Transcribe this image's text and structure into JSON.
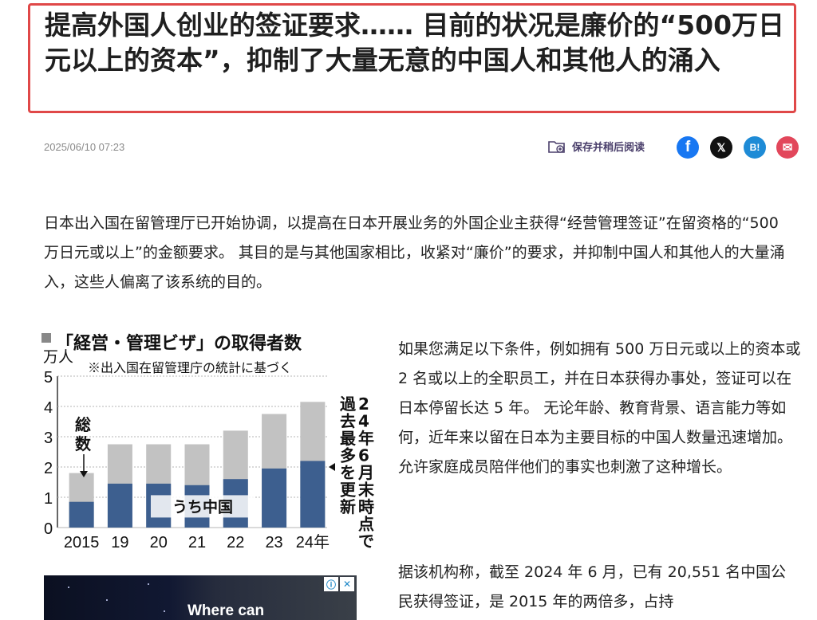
{
  "article": {
    "headline": "提高外国人创业的签证要求…… 目前的状况是廉价的“500万日元以上的资本”，抑制了大量无意的中国人和其他人的涌入",
    "date": "2025/06/10 07:23",
    "save_label": "保存并稍后阅读",
    "intro": "日本出入国在留管理厅已开始协调，以提高在日本开展业务的外国企业主获得“经营管理签证”在留资格的“500 万日元或以上”的金额要求。 其目的是与其他国家相比，收紧对“廉价”的要求，并抑制中国人和其他人的大量涌入，这些人偏离了该系统的目的。",
    "para2": "如果您满足以下条件，例如拥有 500 万日元或以上的资本或 2 名或以上的全职员工，并在日本获得办事处，签证可以在日本停留长达 5 年。 无论年龄、教育背景、语言能力等如何，近年来以留在日本为主要目标的中国人数量迅速增加。 允许家庭成员陪伴他们的事实也刺激了这种增长。",
    "para3": "据该机构称，截至 2024 年 6 月，已有 20,551 名中国公民获得签证，是 2015 年的两倍多，占持"
  },
  "share": {
    "facebook": "f",
    "x": "𝕏",
    "hatena": "B!",
    "mail": "✉"
  },
  "icons": {
    "save": "folder-add-icon",
    "facebook": "facebook-icon",
    "x": "x-icon",
    "hatena": "hatena-icon",
    "mail": "mail-icon"
  },
  "ad": {
    "text": "Where can",
    "info": "ⓘ",
    "close": "✕"
  },
  "chart_data": {
    "type": "bar",
    "title": "「経営・管理ビザ」の取得者数",
    "subtitle": "※出入国在留管理庁の統計に基づく",
    "ylabel": "万人",
    "ylim": [
      0,
      5
    ],
    "yticks": [
      "0",
      "1",
      "2",
      "3",
      "4",
      "5"
    ],
    "categories": [
      "2015",
      "19",
      "20",
      "21",
      "22",
      "23",
      "24年"
    ],
    "series": [
      {
        "name": "総数",
        "values": [
          1.8,
          2.75,
          2.75,
          2.75,
          3.2,
          3.75,
          4.15
        ]
      },
      {
        "name": "うち中国",
        "values": [
          0.85,
          1.45,
          1.45,
          1.4,
          1.6,
          1.95,
          2.2
        ]
      }
    ],
    "annotations": {
      "total": "総数",
      "china": "うち中国",
      "note_col1": "24年6月末時点で",
      "note_col2": "過去最多を更新"
    },
    "colors": {
      "total": "#c2c2c2",
      "china": "#3d5f8f"
    }
  }
}
